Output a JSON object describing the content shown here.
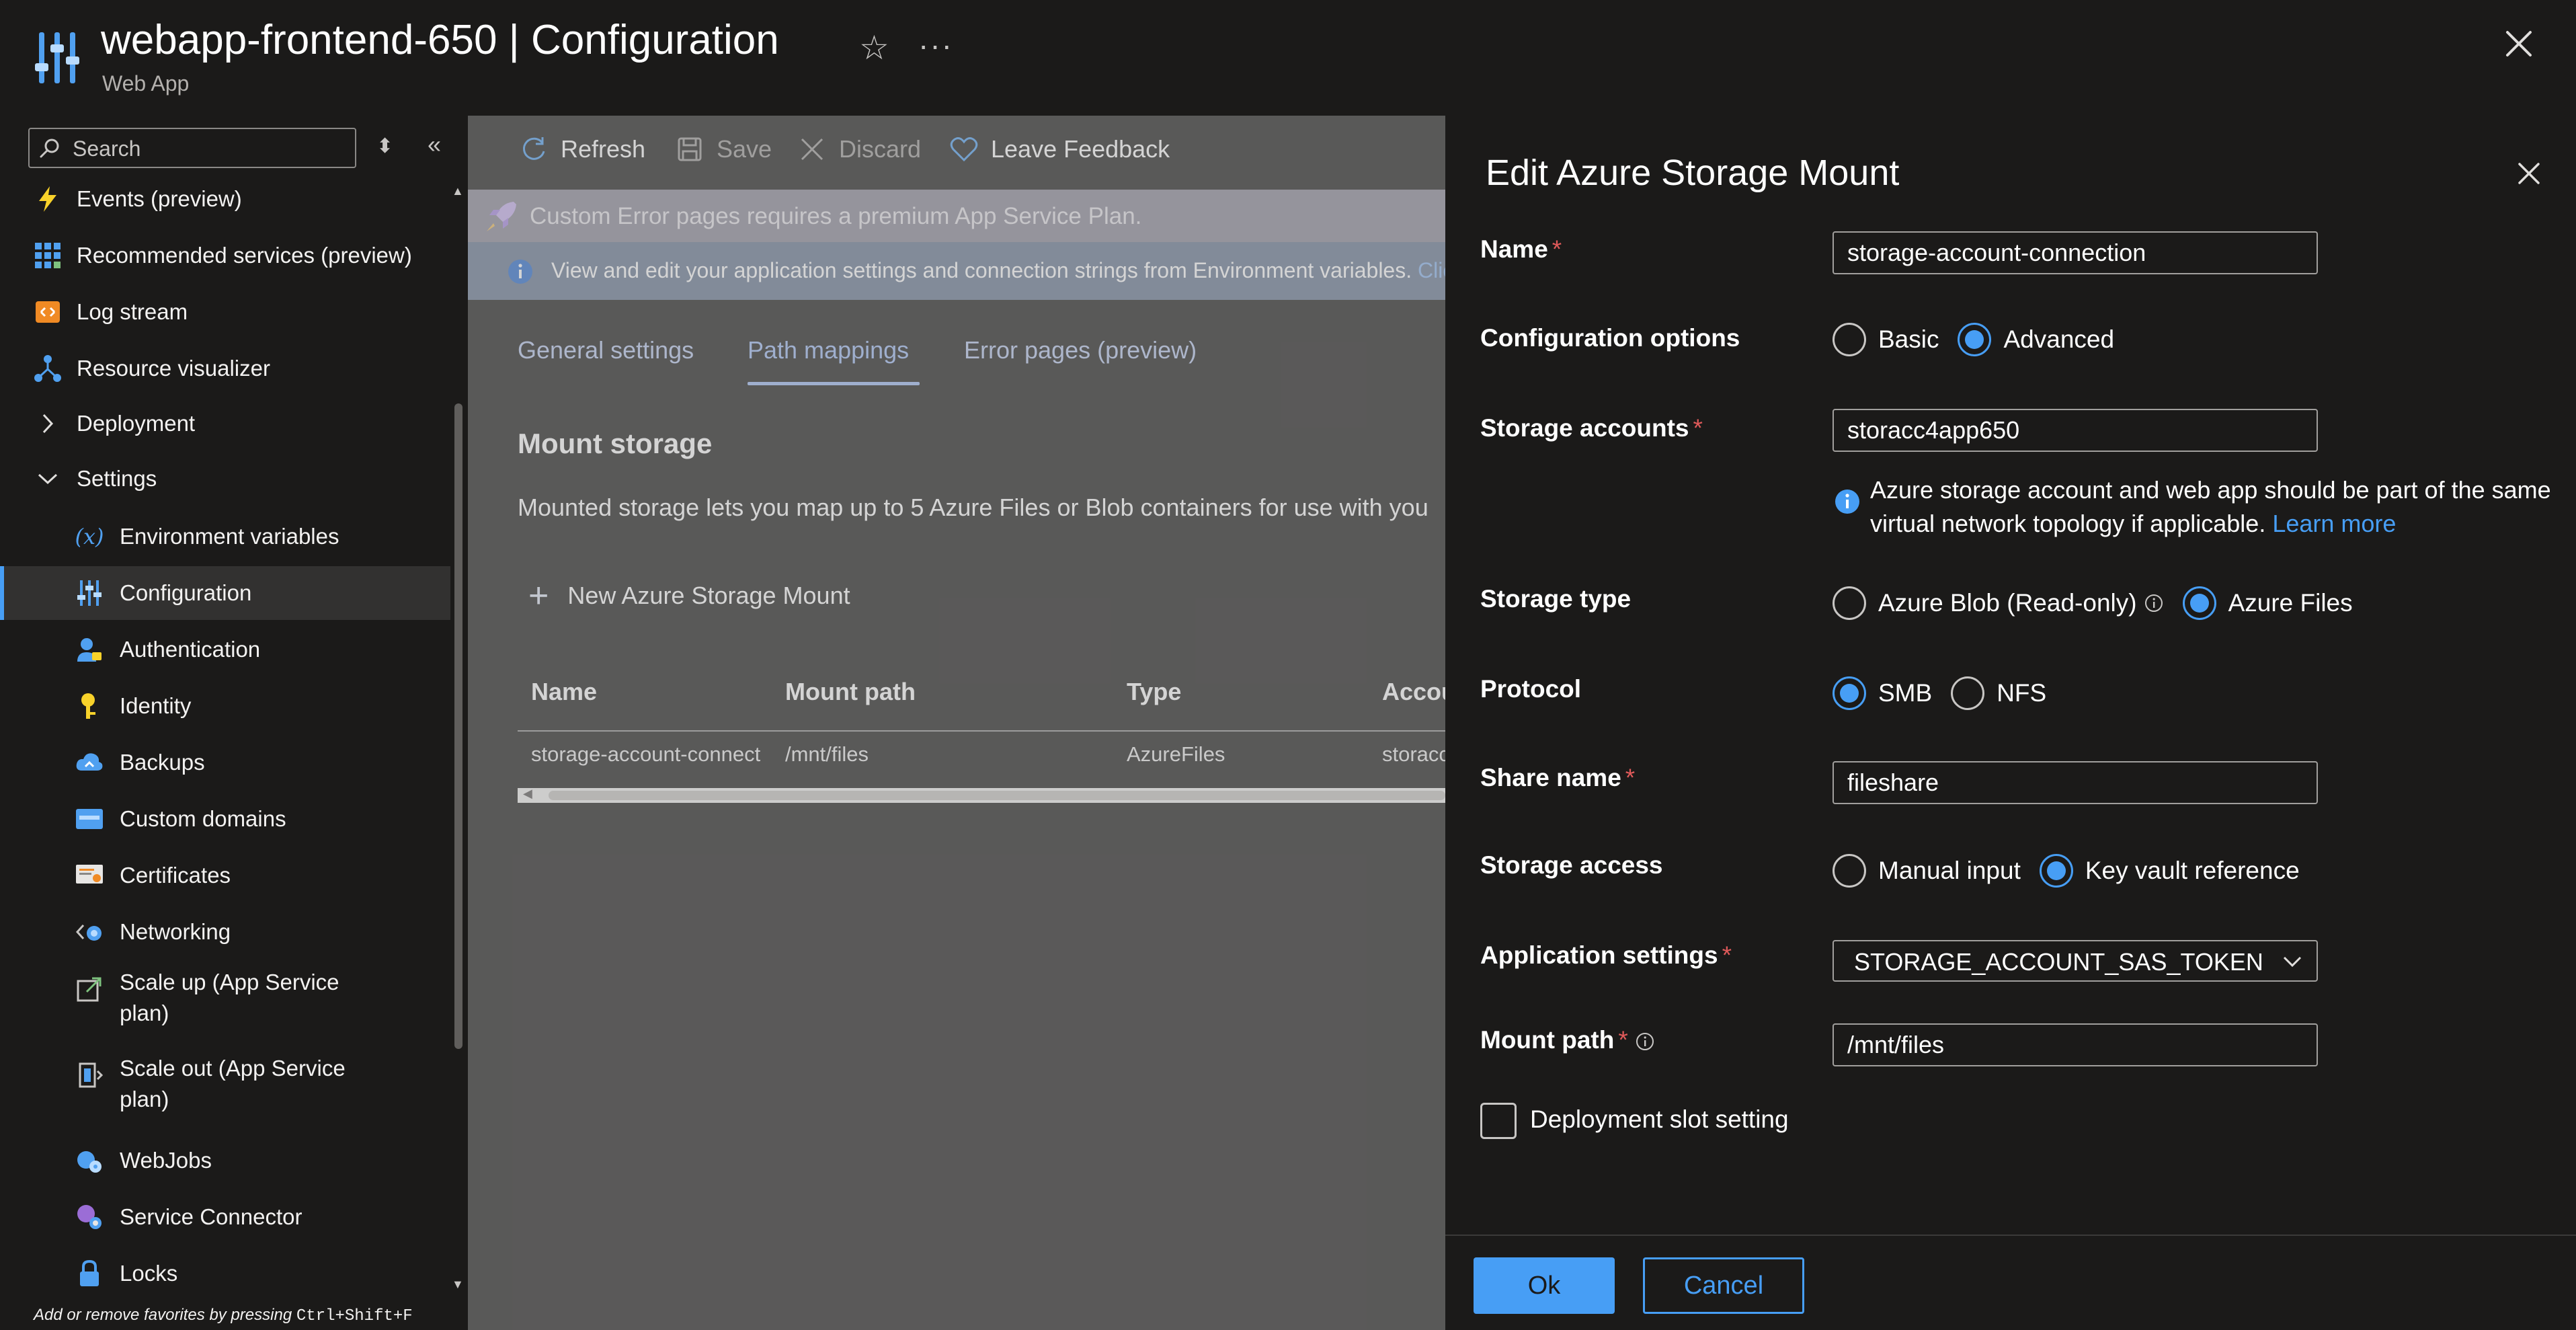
{
  "header": {
    "title": "webapp-frontend-650 | Configuration",
    "subtitle": "Web App",
    "favorite_glyph": "☆",
    "more_glyph": "···"
  },
  "sidebar": {
    "search_placeholder": "Search",
    "items": [
      {
        "label": "Events (preview)",
        "icon": "lightning-icon"
      },
      {
        "label": "Recommended services (preview)",
        "icon": "grid-icon"
      },
      {
        "label": "Log stream",
        "icon": "log-stream-icon"
      },
      {
        "label": "Resource visualizer",
        "icon": "resource-visualizer-icon"
      },
      {
        "label": "Deployment",
        "icon": "chevron-right-icon"
      },
      {
        "label": "Settings",
        "icon": "chevron-down-icon"
      },
      {
        "label": "Environment variables",
        "icon": "variable-icon"
      },
      {
        "label": "Configuration",
        "icon": "configuration-icon",
        "active": true
      },
      {
        "label": "Authentication",
        "icon": "authentication-icon"
      },
      {
        "label": "Identity",
        "icon": "identity-icon"
      },
      {
        "label": "Backups",
        "icon": "backups-icon"
      },
      {
        "label": "Custom domains",
        "icon": "custom-domains-icon"
      },
      {
        "label": "Certificates",
        "icon": "certificates-icon"
      },
      {
        "label": "Networking",
        "icon": "networking-icon"
      },
      {
        "label": "Scale up (App Service\nplan)",
        "icon": "scale-up-icon"
      },
      {
        "label": "Scale out (App Service\nplan)",
        "icon": "scale-out-icon"
      },
      {
        "label": "WebJobs",
        "icon": "webjobs-icon"
      },
      {
        "label": "Service Connector",
        "icon": "service-connector-icon"
      },
      {
        "label": "Locks",
        "icon": "lock-icon"
      }
    ],
    "favorites_hint": "Add or remove favorites by pressing",
    "favorites_shortcut": "Ctrl+Shift+F"
  },
  "toolbar": {
    "refresh_label": "Refresh",
    "save_label": "Save",
    "discard_label": "Discard",
    "feedback_label": "Leave Feedback"
  },
  "banners": {
    "premium": "Custom Error pages requires a premium App Service Plan.",
    "env_text": "View and edit your application settings and connection strings from Environment variables.",
    "env_link": "Click"
  },
  "tabs": [
    {
      "label": "General settings"
    },
    {
      "label": "Path mappings",
      "active": true
    },
    {
      "label": "Error pages (preview)"
    }
  ],
  "mount": {
    "title": "Mount storage",
    "description": "Mounted storage lets you map up to 5 Azure Files or Blob containers for use with you",
    "new_button": "New Azure Storage Mount",
    "columns": [
      "Name",
      "Mount path",
      "Type",
      "Accou"
    ],
    "rows": [
      [
        "storage-account-connect",
        "/mnt/files",
        "AzureFiles",
        "storacc"
      ]
    ]
  },
  "panel": {
    "title": "Edit Azure Storage Mount",
    "name_label": "Name",
    "name_value": "storage-account-connection",
    "config_label": "Configuration options",
    "config_basic": "Basic",
    "config_advanced": "Advanced",
    "config_selected": "Advanced",
    "storage_accounts_label": "Storage accounts",
    "storage_accounts_value": "storacc4app650",
    "storage_info_text": "Azure storage account and web app should be part of the same virtual network topology if applicable.",
    "storage_info_link": "Learn more",
    "storage_type_label": "Storage type",
    "storage_type_blob": "Azure Blob (Read-only)",
    "storage_type_files": "Azure Files",
    "storage_type_selected": "Azure Files",
    "protocol_label": "Protocol",
    "protocol_smb": "SMB",
    "protocol_nfs": "NFS",
    "protocol_selected": "SMB",
    "share_name_label": "Share name",
    "share_name_value": "fileshare",
    "storage_access_label": "Storage access",
    "storage_access_manual": "Manual input",
    "storage_access_keyvault": "Key vault reference",
    "storage_access_selected": "Key vault reference",
    "app_settings_label": "Application settings",
    "app_settings_value": "STORAGE_ACCOUNT_SAS_TOKEN",
    "mount_path_label": "Mount path",
    "mount_path_value": "/mnt/files",
    "slot_setting_label": "Deployment slot setting",
    "slot_setting_checked": false,
    "ok_label": "Ok",
    "cancel_label": "Cancel",
    "required_mark": "*"
  },
  "colors": {
    "accent": "#479ef5",
    "required": "#e05a5a",
    "background": "#1b1a19"
  }
}
